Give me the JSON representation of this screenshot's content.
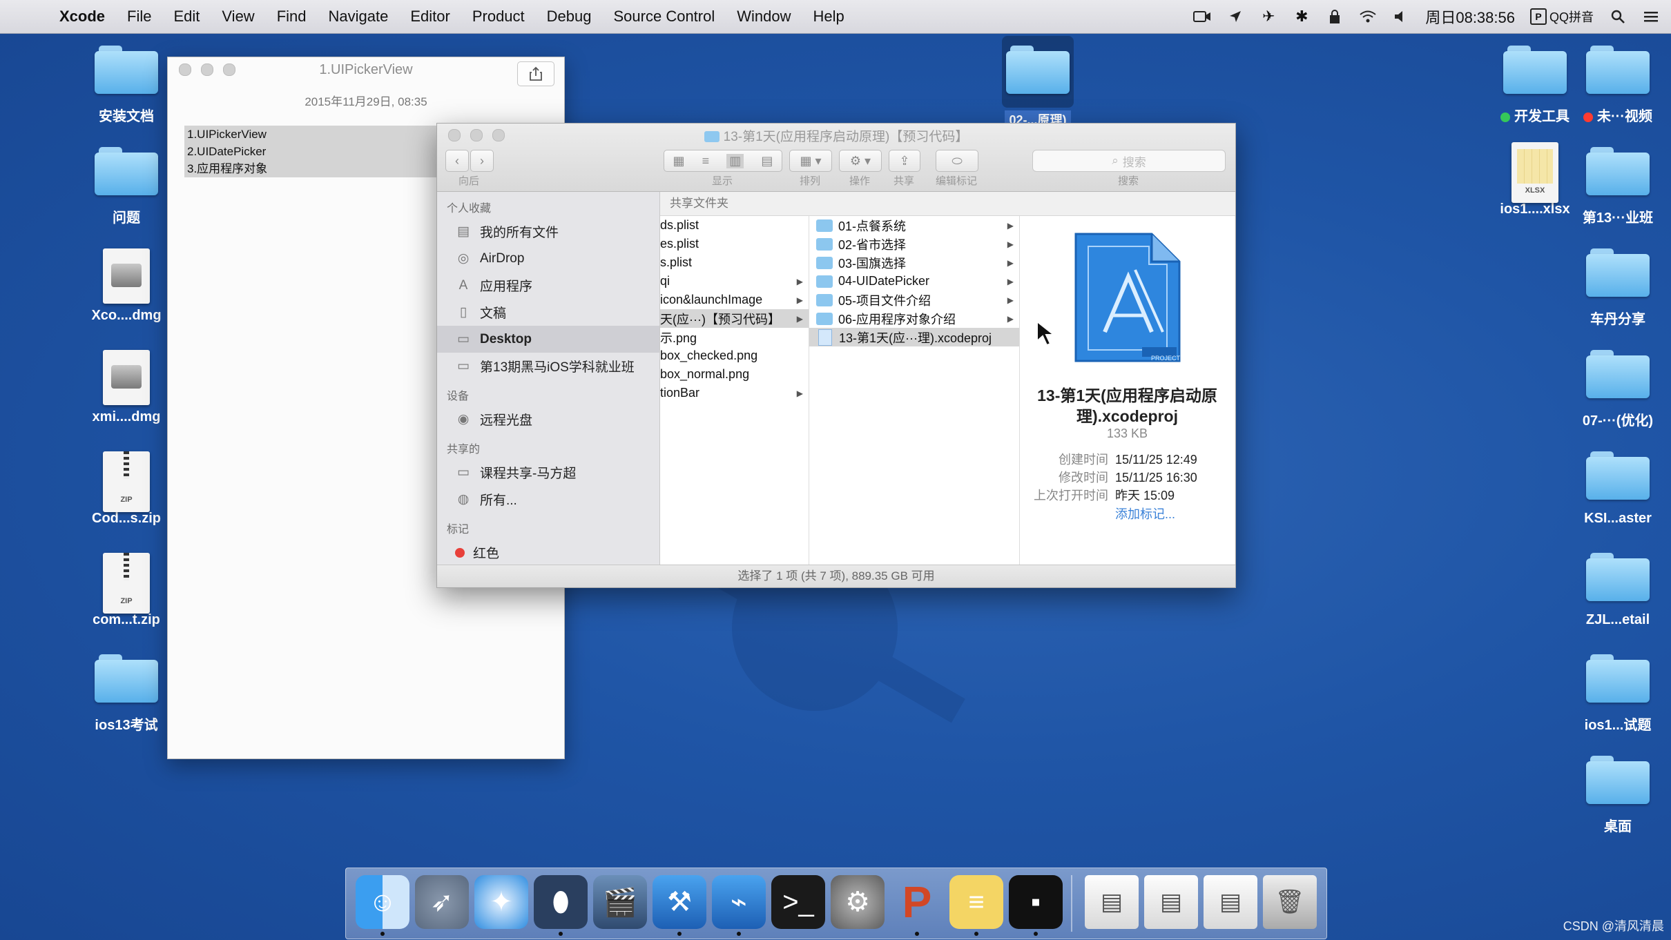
{
  "menubar": {
    "app": "Xcode",
    "items": [
      "File",
      "Edit",
      "View",
      "Find",
      "Navigate",
      "Editor",
      "Product",
      "Debug",
      "Source Control",
      "Window",
      "Help"
    ],
    "clock": "周日08:38:56",
    "input_method": "QQ拼音"
  },
  "desktop_left": [
    {
      "label": "安装文档",
      "kind": "folder"
    },
    {
      "label": "问题",
      "kind": "folder"
    },
    {
      "label": "Xco....dmg",
      "kind": "dmg"
    },
    {
      "label": "xmi....dmg",
      "kind": "dmg"
    },
    {
      "label": "Cod...s.zip",
      "kind": "zip",
      "badge": "ZIP"
    },
    {
      "label": "com...t.zip",
      "kind": "zip",
      "badge": "ZIP"
    },
    {
      "label": "ios13考试",
      "kind": "folder"
    }
  ],
  "desktop_right_col1": [
    {
      "label": "开发工具",
      "kind": "folder",
      "tag": "#35c759"
    },
    {
      "label": "ios1....xlsx",
      "kind": "xlsx",
      "badge": "XLSX"
    }
  ],
  "desktop_right_col2": [
    {
      "label": "未···视频",
      "kind": "folder",
      "tag": "#ff3b30"
    },
    {
      "label": "第13···业班",
      "kind": "folder"
    },
    {
      "label": "车丹分享",
      "kind": "folder"
    },
    {
      "label": "07-···(优化)",
      "kind": "folder"
    },
    {
      "label": "KSI...aster",
      "kind": "folder"
    },
    {
      "label": "ZJL...etail",
      "kind": "folder"
    },
    {
      "label": "ios1...试题",
      "kind": "folder"
    },
    {
      "label": "桌面",
      "kind": "folder"
    }
  ],
  "center_folder": {
    "label": "02-...原理)"
  },
  "text_window": {
    "title": "1.UIPickerView",
    "date": "2015年11月29日, 08:35",
    "lines": [
      "1.UIPickerView",
      "2.UIDatePicker",
      "3.应用程序对象"
    ]
  },
  "finder": {
    "title": "13-第1天(应用程序启动原理)【预习代码】",
    "toolbar_labels": {
      "nav": "向后",
      "view": "显示",
      "arrange": "排列",
      "action": "操作",
      "share": "共享",
      "tags": "编辑标记",
      "search": "搜索"
    },
    "search_placeholder": "搜索",
    "sidebar": {
      "favorites_header": "个人收藏",
      "favorites": [
        {
          "label": "我的所有文件",
          "icon": "all-files-icon"
        },
        {
          "label": "AirDrop",
          "icon": "airdrop-icon"
        },
        {
          "label": "应用程序",
          "icon": "applications-icon"
        },
        {
          "label": "文稿",
          "icon": "documents-icon"
        },
        {
          "label": "Desktop",
          "icon": "desktop-icon",
          "selected": true
        },
        {
          "label": "第13期黑马iOS学科就业班",
          "icon": "folder-icon"
        }
      ],
      "devices_header": "设备",
      "devices": [
        {
          "label": "远程光盘",
          "icon": "disc-icon"
        }
      ],
      "shared_header": "共享的",
      "shared": [
        {
          "label": "课程共享-马方超",
          "icon": "computer-icon"
        },
        {
          "label": "所有...",
          "icon": "network-icon"
        }
      ],
      "tags_header": "标记",
      "tags": [
        {
          "label": "红色",
          "color": "#e8403a"
        }
      ]
    },
    "path_header": "共享文件夹",
    "column1": [
      {
        "label": "ds.plist",
        "arrow": false
      },
      {
        "label": "es.plist",
        "arrow": false
      },
      {
        "label": "s.plist",
        "arrow": false
      },
      {
        "label": "qi",
        "arrow": true
      },
      {
        "label": "icon&launchImage",
        "arrow": true
      },
      {
        "label": "天(应···)【预习代码】",
        "arrow": true,
        "selected": true
      },
      {
        "label": "示.png",
        "arrow": false
      },
      {
        "label": "box_checked.png",
        "arrow": false
      },
      {
        "label": "box_normal.png",
        "arrow": false
      },
      {
        "label": "tionBar",
        "arrow": true
      }
    ],
    "column2": [
      {
        "label": "01-点餐系统",
        "kind": "folder"
      },
      {
        "label": "02-省市选择",
        "kind": "folder"
      },
      {
        "label": "03-国旗选择",
        "kind": "folder"
      },
      {
        "label": "04-UIDatePicker",
        "kind": "folder"
      },
      {
        "label": "05-项目文件介绍",
        "kind": "folder"
      },
      {
        "label": "06-应用程序对象介绍",
        "kind": "folder"
      },
      {
        "label": "13-第1天(应···理).xcodeproj",
        "kind": "project",
        "selected": true
      }
    ],
    "preview": {
      "name": "13-第1天(应用程序启动原理).xcodeproj",
      "badge": "PROJECT",
      "size": "133 KB",
      "meta": [
        {
          "key": "创建时间",
          "value": "15/11/25 12:49"
        },
        {
          "key": "修改时间",
          "value": "15/11/25 16:30"
        },
        {
          "key": "上次打开时间",
          "value": "昨天 15:09"
        }
      ],
      "add_tags": "添加标记..."
    },
    "status": "选择了 1 项 (共 7 项), 889.35 GB 可用"
  },
  "dock": {
    "apps": [
      "finder-icon",
      "launchpad-icon",
      "safari-icon",
      "mouse-icon",
      "movie-icon",
      "xcode-icon",
      "instruments-icon",
      "terminal-icon",
      "system-preferences-icon",
      "powerpoint-icon",
      "notes-icon",
      "console-icon"
    ],
    "docs": [
      "preview-doc-icon",
      "file-doc-icon",
      "screenshot-doc-icon",
      "trash-icon"
    ],
    "colors": {
      "finder": "#3b9ef0",
      "launchpad": "#5a6a80",
      "safari": "#2f8de0",
      "mouse": "#2a3f5f",
      "terminal": "#1a1a1a",
      "powerpoint": "#d24726",
      "notes": "#f4d564",
      "console": "#111111"
    }
  },
  "credit": "CSDN @清风清晨"
}
